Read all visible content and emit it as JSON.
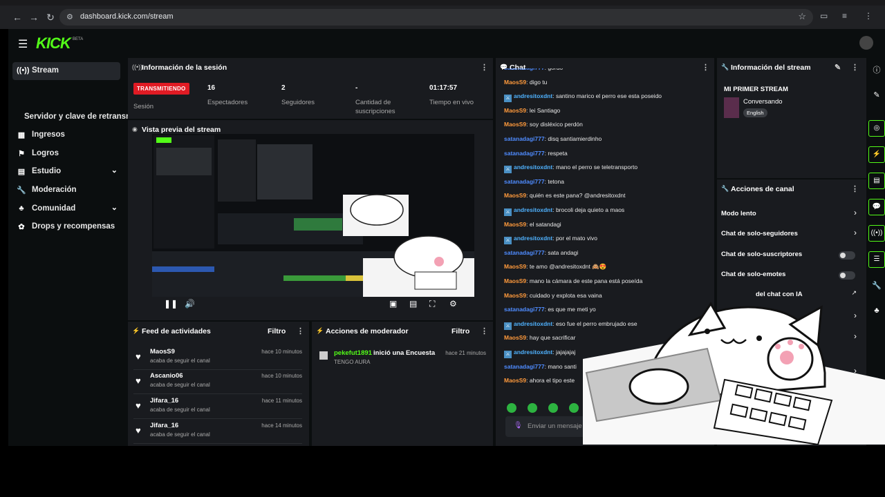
{
  "browser": {
    "url": "dashboard.kick.com/stream"
  },
  "topbar": {
    "logo": "KICK",
    "logo_badge": "BETA"
  },
  "sidebar": {
    "items": [
      {
        "label": "Stream",
        "icon": "broadcast-icon"
      },
      {
        "label": "Servidor y clave de retransmisión",
        "icon": ""
      },
      {
        "label": "Ingresos",
        "icon": "chart-icon"
      },
      {
        "label": "Logros",
        "icon": "flag-icon"
      },
      {
        "label": "Estudio",
        "icon": "studio-icon"
      },
      {
        "label": "Moderación",
        "icon": "wrench-icon"
      },
      {
        "label": "Comunidad",
        "icon": "community-icon"
      },
      {
        "label": "Drops y recompensas",
        "icon": "gift-icon"
      }
    ]
  },
  "session": {
    "title": "Información de la sesión",
    "live_badge": "TRANSMITIENDO",
    "session_label": "Sesión",
    "stats": [
      {
        "value": "16",
        "label": "Espectadores"
      },
      {
        "value": "2",
        "label": "Seguidores"
      },
      {
        "value": "-",
        "label": "Cantidad de suscripciones"
      },
      {
        "value": "01:17:57",
        "label": "Tiempo en vivo"
      }
    ]
  },
  "preview": {
    "title": "Vista previa del stream"
  },
  "feed": {
    "title": "Feed de actividades",
    "filter": "Filtro",
    "items": [
      {
        "name": "MaosS9",
        "sub": "acaba de seguir el canal",
        "time": "hace 10 minutos"
      },
      {
        "name": "Ascanio06",
        "sub": "acaba de seguir el canal",
        "time": "hace 10 minutos"
      },
      {
        "name": "Jifara_16",
        "sub": "acaba de seguir el canal",
        "time": "hace 11 minutos"
      },
      {
        "name": "Jifara_16",
        "sub": "acaba de seguir el canal",
        "time": "hace 14 minutos"
      }
    ]
  },
  "mod": {
    "title": "Acciones de moderador",
    "filter": "Filtro",
    "item": {
      "name": "pekefut1891",
      "action": "inició una Encuesta",
      "sub": "TENGO AURA",
      "time": "hace 21 minutos"
    }
  },
  "chat": {
    "title": "Chat",
    "input_placeholder": "Enviar un mensaje",
    "messages": [
      {
        "user": "satanadagi777",
        "text": "gordo",
        "color": "#4f8cff",
        "badge": false
      },
      {
        "user": "MaosS9",
        "text": "digo tu",
        "color": "#ff9a3c",
        "badge": false
      },
      {
        "user": "andresitoxdnt",
        "text": "santino marico el perro ese esta poseido",
        "color": "#4fb2ff",
        "badge": true
      },
      {
        "user": "MaosS9",
        "text": "lei Santiago",
        "color": "#ff9a3c",
        "badge": false
      },
      {
        "user": "MaosS9",
        "text": "soy disléxico perdón",
        "color": "#ff9a3c",
        "badge": false
      },
      {
        "user": "satanadagi777",
        "text": "disq santiamierdinho",
        "color": "#4f8cff",
        "badge": false
      },
      {
        "user": "satanadagi777",
        "text": "respeta",
        "color": "#4f8cff",
        "badge": false
      },
      {
        "user": "andresitoxdnt",
        "text": "mano el perro se teletransporto",
        "color": "#4fb2ff",
        "badge": true
      },
      {
        "user": "satanadagi777",
        "text": "tetona",
        "color": "#4f8cff",
        "badge": false
      },
      {
        "user": "MaosS9",
        "text": "quién es este pana? @andresitoxdnt",
        "color": "#ff9a3c",
        "badge": false
      },
      {
        "user": "andresitoxdnt",
        "text": "brocoli deja quieto a maos",
        "color": "#4fb2ff",
        "badge": true
      },
      {
        "user": "MaosS9",
        "text": "el satandagi",
        "color": "#ff9a3c",
        "badge": false
      },
      {
        "user": "andresitoxdnt",
        "text": "por el mato vivo",
        "color": "#4fb2ff",
        "badge": true
      },
      {
        "user": "satanadagi777",
        "text": "sata andagi",
        "color": "#4f8cff",
        "badge": false
      },
      {
        "user": "MaosS9",
        "text": "te amo @andresitoxdnt 🙈😍",
        "color": "#ff9a3c",
        "badge": false
      },
      {
        "user": "MaosS9",
        "text": "mano la cámara de este pana está poseída",
        "color": "#ff9a3c",
        "badge": false
      },
      {
        "user": "MaosS9",
        "text": "cuidado y explota esa vaina",
        "color": "#ff9a3c",
        "badge": false
      },
      {
        "user": "satanadagi777",
        "text": "es que me meti yo",
        "color": "#4f8cff",
        "badge": false
      },
      {
        "user": "andresitoxdnt",
        "text": "eso fue el perro embrujado ese",
        "color": "#4fb2ff",
        "badge": true
      },
      {
        "user": "MaosS9",
        "text": "hay que sacrificar",
        "color": "#ff9a3c",
        "badge": false
      },
      {
        "user": "andresitoxdnt",
        "text": "jajajajaj",
        "color": "#4fb2ff",
        "badge": true
      },
      {
        "user": "satanadagi777",
        "text": "mano santi",
        "color": "#4f8cff",
        "badge": false
      },
      {
        "user": "MaosS9",
        "text": "ahora el tipo este",
        "color": "#ff9a3c",
        "badge": false
      }
    ]
  },
  "stream_info": {
    "title": "Información del stream",
    "stream_title": "MI PRIMER STREAM",
    "category": "Conversando",
    "tag": "English"
  },
  "channel_actions": {
    "title": "Acciones de canal",
    "items": [
      {
        "label": "Modo lento",
        "control": "chevron"
      },
      {
        "label": "Chat de solo-seguidores",
        "control": "chevron"
      },
      {
        "label": "Chat de solo-suscriptores",
        "control": "toggle"
      },
      {
        "label": "Chat de solo-emotes",
        "control": "toggle"
      },
      {
        "label": "del chat con IA",
        "control": "external"
      }
    ]
  },
  "colors": {
    "accent": "#53fc18",
    "live": "#e01b24",
    "panel": "#191b1f",
    "bg": "#0b0e0f"
  }
}
